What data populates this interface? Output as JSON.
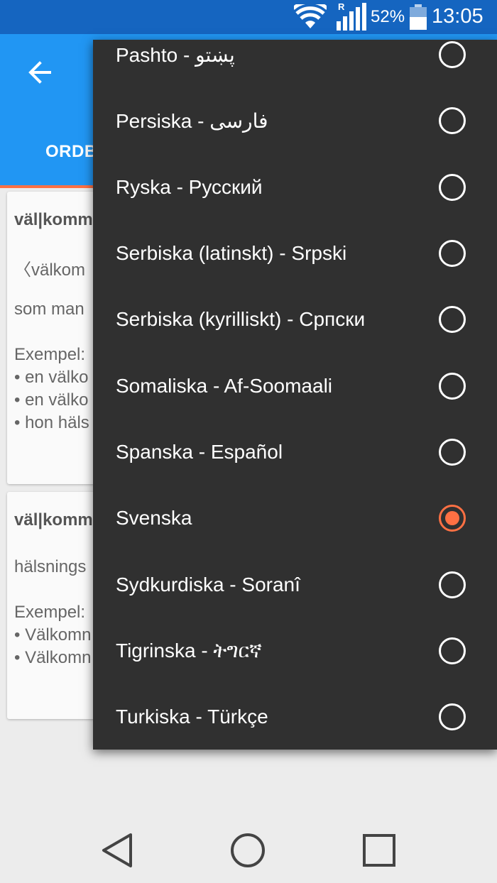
{
  "status_bar": {
    "signal_badge": "R",
    "battery_percent": "52%",
    "time": "13:05"
  },
  "app_bar": {
    "tab_label": "ORDB"
  },
  "cards": [
    {
      "lines": [
        "väl|komm",
        "〈välkom",
        "som man",
        "Exempel:",
        "• en välko",
        "• en välko",
        "• hon häls"
      ]
    },
    {
      "lines": [
        "väl|komm",
        "hälsnings",
        "Exempel:",
        "• Välkomn",
        "• Välkomn"
      ]
    }
  ],
  "language_menu": {
    "selected": "Svenska",
    "options": [
      {
        "label": "Pashto - پښتو",
        "selected": false
      },
      {
        "label": "Persiska - فارسی",
        "selected": false
      },
      {
        "label": "Ryska - Русский",
        "selected": false
      },
      {
        "label": "Serbiska (latinskt) - Srpski",
        "selected": false
      },
      {
        "label": "Serbiska (kyrilliskt) - Српски",
        "selected": false
      },
      {
        "label": "Somaliska - Af-Soomaali",
        "selected": false
      },
      {
        "label": "Spanska - Español",
        "selected": false
      },
      {
        "label": "Svenska",
        "selected": true
      },
      {
        "label": "Sydkurdiska - Soranî",
        "selected": false
      },
      {
        "label": "Tigrinska - ትግርኛ",
        "selected": false
      },
      {
        "label": "Turkiska - Türkçe",
        "selected": false
      }
    ]
  },
  "colors": {
    "status_bar": "#1565c0",
    "app_bar": "#2196f3",
    "accent": "#ff7043",
    "menu_background": "#303030"
  },
  "nav_bar": {
    "icons": [
      "back-icon",
      "home-icon",
      "recents-icon"
    ]
  }
}
